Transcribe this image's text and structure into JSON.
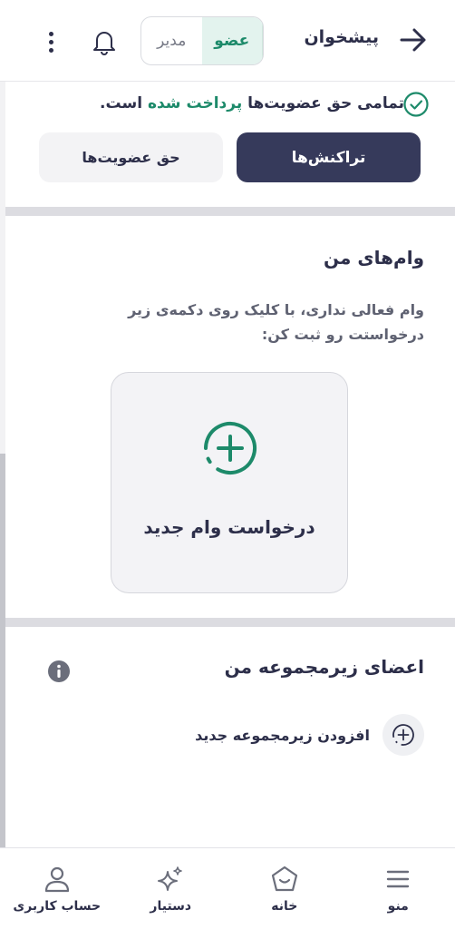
{
  "header": {
    "title": "پیشخوان",
    "role_member": "عضو",
    "role_manager": "مدیر"
  },
  "membership": {
    "status_prefix": "تمامی حق عضویت‌ها",
    "status_highlight": "پرداخت شده",
    "status_suffix": "است.",
    "transactions_label": "تراکنش‌ها",
    "fees_label": "حق عضویت‌ها"
  },
  "loans": {
    "title": "وام‌های من",
    "description": "وام فعالی نداری، با کلیک روی دکمه‌ی زیر درخواستت رو ثبت کن:",
    "new_loan_label": "درخواست وام جدید"
  },
  "subgroup": {
    "title": "اعضای زیرمجموعه من",
    "add_label": "افزودن زیرمجموعه جدید"
  },
  "bottom_nav": {
    "items": [
      {
        "label": "منو",
        "icon": "menu-icon"
      },
      {
        "label": "خانه",
        "icon": "home-icon"
      },
      {
        "label": "دستیار",
        "icon": "sparkle-icon"
      },
      {
        "label": "حساب کاربری",
        "icon": "user-icon"
      }
    ]
  },
  "colors": {
    "primary": "#363a5b",
    "accent_green": "#1d8a6a"
  }
}
